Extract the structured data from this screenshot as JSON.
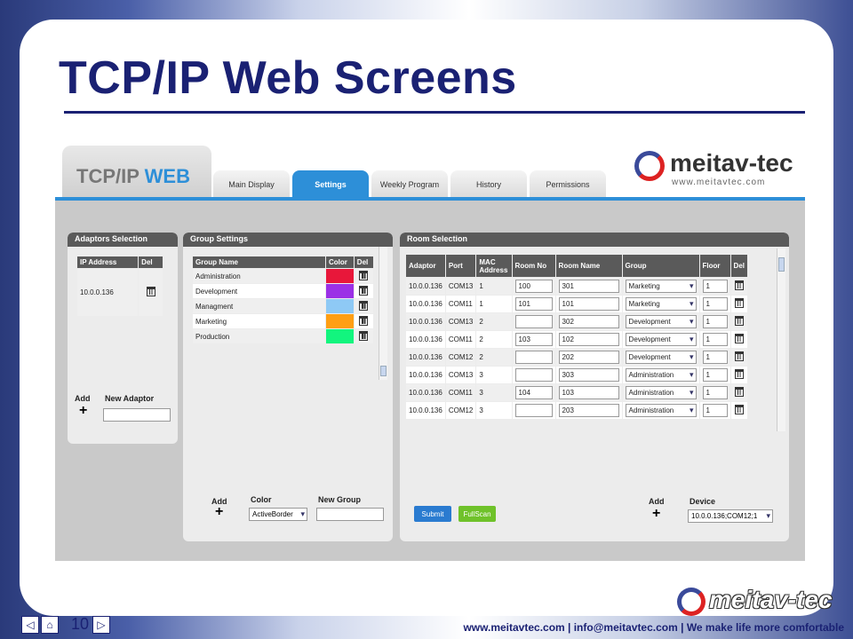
{
  "slide": {
    "title": "TCP/IP Web Screens",
    "page_number": "10",
    "footer_text": "www.meitavtec.com | info@meitavtec.com | We make life more comfortable",
    "footer_logo": "meitav-tec"
  },
  "app": {
    "logo_prefix": "TCP/IP",
    "logo_suffix": "WEB",
    "brand_name": "meitav-tec",
    "brand_url": "www.meitavtec.com",
    "tabs": [
      "Main Display",
      "Settings",
      "Weekly Program",
      "History",
      "Permissions"
    ],
    "active_tab": "Settings",
    "adaptors": {
      "title": "Adaptors Selection",
      "columns": [
        "IP Address",
        "Del"
      ],
      "rows": [
        "10.0.0.136"
      ],
      "add_label": "Add",
      "new_label": "New Adaptor"
    },
    "groups": {
      "title": "Group Settings",
      "columns": [
        "Group Name",
        "Color",
        "Del"
      ],
      "rows": [
        {
          "name": "Administration",
          "color": "#e8173a"
        },
        {
          "name": "Development",
          "color": "#9b30e6"
        },
        {
          "name": "Managment",
          "color": "#8ec9f5"
        },
        {
          "name": "Marketing",
          "color": "#ff9f14"
        },
        {
          "name": "Production",
          "color": "#12f57e"
        }
      ],
      "add_label": "Add",
      "color_label": "Color",
      "color_value": "ActiveBorder",
      "new_label": "New Group"
    },
    "rooms": {
      "title": "Room Selection",
      "columns": [
        "Adaptor",
        "Port",
        "MAC Address",
        "Room No",
        "Room Name",
        "Group",
        "Floor",
        "Del"
      ],
      "rows": [
        {
          "adaptor": "10.0.0.136",
          "port": "COM13",
          "mac": "1",
          "room_no": "100",
          "room_name": "301",
          "group": "Marketing",
          "floor": "1"
        },
        {
          "adaptor": "10.0.0.136",
          "port": "COM11",
          "mac": "1",
          "room_no": "101",
          "room_name": "101",
          "group": "Marketing",
          "floor": "1"
        },
        {
          "adaptor": "10.0.0.136",
          "port": "COM13",
          "mac": "2",
          "room_no": "",
          "room_name": "302",
          "group": "Development",
          "floor": "1"
        },
        {
          "adaptor": "10.0.0.136",
          "port": "COM11",
          "mac": "2",
          "room_no": "103",
          "room_name": "102",
          "group": "Development",
          "floor": "1"
        },
        {
          "adaptor": "10.0.0.136",
          "port": "COM12",
          "mac": "2",
          "room_no": "",
          "room_name": "202",
          "group": "Development",
          "floor": "1"
        },
        {
          "adaptor": "10.0.0.136",
          "port": "COM13",
          "mac": "3",
          "room_no": "",
          "room_name": "303",
          "group": "Administration",
          "floor": "1"
        },
        {
          "adaptor": "10.0.0.136",
          "port": "COM11",
          "mac": "3",
          "room_no": "104",
          "room_name": "103",
          "group": "Administration",
          "floor": "1"
        },
        {
          "adaptor": "10.0.0.136",
          "port": "COM12",
          "mac": "3",
          "room_no": "",
          "room_name": "203",
          "group": "Administration",
          "floor": "1"
        }
      ],
      "submit_label": "Submit",
      "fullscan_label": "FullScan",
      "add_label": "Add",
      "device_label": "Device",
      "device_value": "10.0.0.136;COM12;1"
    }
  }
}
